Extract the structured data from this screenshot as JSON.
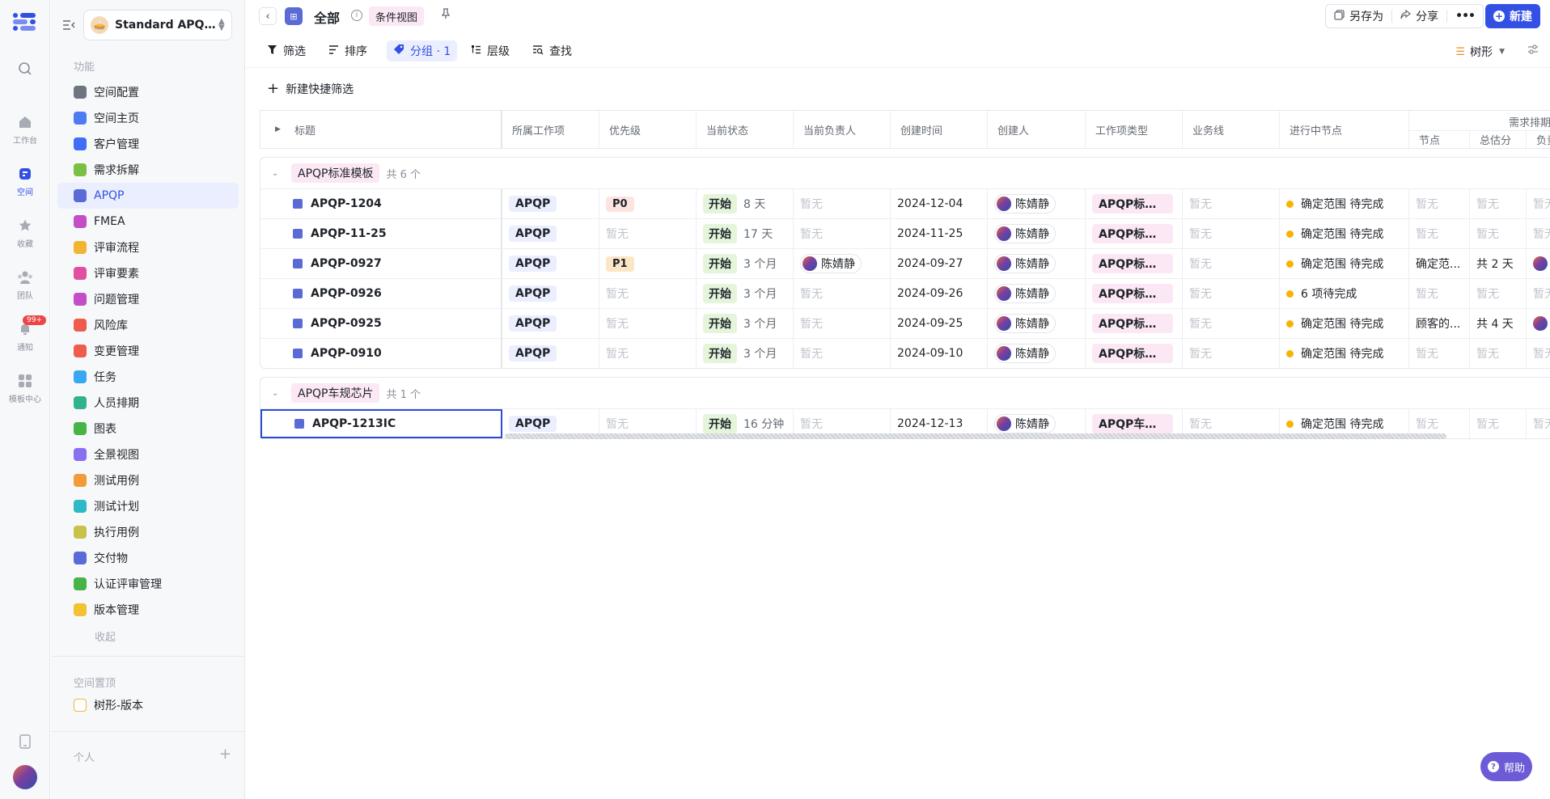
{
  "rail": {
    "items": [
      {
        "label": "工作台",
        "icon": "home-icon"
      },
      {
        "label": "空间",
        "icon": "space-icon"
      },
      {
        "label": "收藏",
        "icon": "star-icon"
      },
      {
        "label": "团队",
        "icon": "team-icon"
      },
      {
        "label": "通知",
        "icon": "bell-icon",
        "badge": "99+"
      },
      {
        "label": "模板中心",
        "icon": "grid-icon"
      }
    ]
  },
  "sidebar": {
    "space_name": "Standard APQP...",
    "section_features": "功能",
    "items": [
      {
        "label": "空间配置",
        "color": "#6e7480"
      },
      {
        "label": "空间主页",
        "color": "#4c7cf0"
      },
      {
        "label": "客户管理",
        "color": "#3d6ef5"
      },
      {
        "label": "需求拆解",
        "color": "#7ac143"
      },
      {
        "label": "APQP",
        "color": "#5b6bd6"
      },
      {
        "label": "FMEA",
        "color": "#c24fc8"
      },
      {
        "label": "评审流程",
        "color": "#f2b531"
      },
      {
        "label": "评审要素",
        "color": "#e04fa0"
      },
      {
        "label": "问题管理",
        "color": "#c24fc8"
      },
      {
        "label": "风险库",
        "color": "#ef5b4c"
      },
      {
        "label": "变更管理",
        "color": "#ef5b4c"
      },
      {
        "label": "任务",
        "color": "#3aa8f0"
      },
      {
        "label": "人员排期",
        "color": "#2fb38f"
      },
      {
        "label": "图表",
        "color": "#46b446"
      },
      {
        "label": "全景视图",
        "color": "#8a6ff0"
      },
      {
        "label": "测试用例",
        "color": "#f29b38"
      },
      {
        "label": "测试计划",
        "color": "#2fb8c6"
      },
      {
        "label": "执行用例",
        "color": "#c9c24a"
      },
      {
        "label": "交付物",
        "color": "#5b6bd6"
      },
      {
        "label": "认证评审管理",
        "color": "#46b446"
      },
      {
        "label": "版本管理",
        "color": "#f2c232"
      }
    ],
    "collapse_label": "收起",
    "section_pinned": "空间置顶",
    "pinned_items": [
      {
        "label": "树形-版本",
        "color": "#f2b531"
      }
    ],
    "section_personal": "个人"
  },
  "header": {
    "title": "全部",
    "condition_tag": "条件视图",
    "save_as": "另存为",
    "share": "分享",
    "more": "•••",
    "new_label": "新建"
  },
  "toolbar": {
    "filter": "筛选",
    "sort": "排序",
    "group": "分组 · 1",
    "level": "层级",
    "find": "查找",
    "view_mode": "树形"
  },
  "quick_filter": {
    "label": "新建快捷筛选"
  },
  "table": {
    "columns": {
      "title": "标题",
      "work_item": "所属工作项",
      "priority": "优先级",
      "status": "当前状态",
      "owner": "当前负责人",
      "created": "创建时间",
      "creator": "创建人",
      "type": "工作项类型",
      "business": "业务线",
      "node": "进行中节点",
      "schedule_group": "需求排期",
      "schedule_node": "节点",
      "schedule_total": "总估分",
      "schedule_owner": "负责"
    },
    "empty": "暂无",
    "groups": [
      {
        "name": "APQP标准模板",
        "count": "共 6 个",
        "rows": [
          {
            "title": "APQP-1204",
            "work_item": "APQP",
            "priority": "P0",
            "status": "开始",
            "duration": "8 天",
            "owner": "",
            "created": "2024-12-04",
            "creator": "陈婧静",
            "type": "APQP标准...",
            "node": "确定范围 待完成",
            "sched_node": "",
            "sched_total": "",
            "sched_owner": false
          },
          {
            "title": "APQP-11-25",
            "work_item": "APQP",
            "priority": "",
            "status": "开始",
            "duration": "17 天",
            "owner": "",
            "created": "2024-11-25",
            "creator": "陈婧静",
            "type": "APQP标准...",
            "node": "确定范围 待完成",
            "sched_node": "",
            "sched_total": "",
            "sched_owner": false
          },
          {
            "title": "APQP-0927",
            "work_item": "APQP",
            "priority": "P1",
            "status": "开始",
            "duration": "3 个月",
            "owner": "陈婧静",
            "created": "2024-09-27",
            "creator": "陈婧静",
            "type": "APQP标准...",
            "node": "确定范围 待完成",
            "sched_node": "确定范...",
            "sched_total": "共 2 天",
            "sched_owner": true
          },
          {
            "title": "APQP-0926",
            "work_item": "APQP",
            "priority": "",
            "status": "开始",
            "duration": "3 个月",
            "owner": "",
            "created": "2024-09-26",
            "creator": "陈婧静",
            "type": "APQP标准...",
            "node": "6 项待完成",
            "sched_node": "",
            "sched_total": "",
            "sched_owner": false
          },
          {
            "title": "APQP-0925",
            "work_item": "APQP",
            "priority": "",
            "status": "开始",
            "duration": "3 个月",
            "owner": "",
            "created": "2024-09-25",
            "creator": "陈婧静",
            "type": "APQP标准...",
            "node": "确定范围 待完成",
            "sched_node": "顾客的...",
            "sched_total": "共 4 天",
            "sched_owner": true
          },
          {
            "title": "APQP-0910",
            "work_item": "APQP",
            "priority": "",
            "status": "开始",
            "duration": "3 个月",
            "owner": "",
            "created": "2024-09-10",
            "creator": "陈婧静",
            "type": "APQP标准...",
            "node": "确定范围 待完成",
            "sched_node": "",
            "sched_total": "",
            "sched_owner": false
          }
        ]
      },
      {
        "name": "APQP车规芯片",
        "count": "共 1 个",
        "rows": [
          {
            "title": "APQP-1213IC",
            "work_item": "APQP",
            "priority": "",
            "status": "开始",
            "duration": "16 分钟",
            "owner": "",
            "created": "2024-12-13",
            "creator": "陈婧静",
            "type": "APQP车规...",
            "node": "确定范围 待完成",
            "sched_node": "",
            "sched_total": "",
            "sched_owner": false
          }
        ]
      }
    ]
  },
  "help": {
    "label": "帮助"
  }
}
